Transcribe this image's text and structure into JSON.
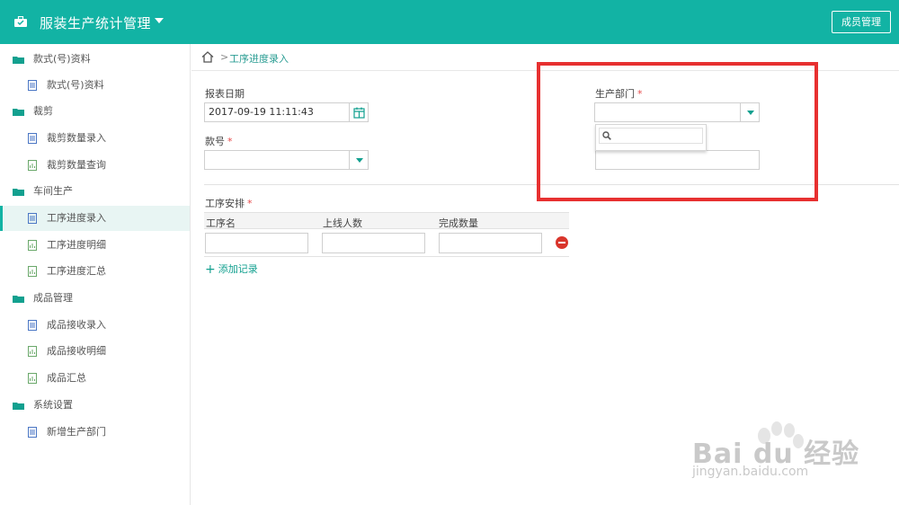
{
  "app": {
    "title": "服装生产统计管理",
    "member_button": "成员管理",
    "accent_color": "#12b3a4"
  },
  "sidebar": {
    "items": [
      {
        "type": "group",
        "label": "款式(号)资料"
      },
      {
        "type": "child",
        "label": "款式(号)资料"
      },
      {
        "type": "group",
        "label": "裁剪"
      },
      {
        "type": "child",
        "label": "裁剪数量录入"
      },
      {
        "type": "child",
        "label": "裁剪数量查询"
      },
      {
        "type": "group",
        "label": "车间生产"
      },
      {
        "type": "child",
        "label": "工序进度录入",
        "active": true
      },
      {
        "type": "child",
        "label": "工序进度明细"
      },
      {
        "type": "child",
        "label": "工序进度汇总"
      },
      {
        "type": "group",
        "label": "成品管理"
      },
      {
        "type": "child",
        "label": "成品接收录入"
      },
      {
        "type": "child",
        "label": "成品接收明细"
      },
      {
        "type": "child",
        "label": "成品汇总"
      },
      {
        "type": "group",
        "label": "系统设置"
      },
      {
        "type": "child",
        "label": "新增生产部门"
      }
    ]
  },
  "breadcrumb": {
    "separator": ">",
    "current": "工序进度录入"
  },
  "form": {
    "report_date_label": "报表日期",
    "report_date_value": "2017-09-19 11:11:43",
    "style_no_label": "款号",
    "department_label": "生产部门",
    "required_mark": "*",
    "process_label": "工序安排",
    "table_headers": [
      "工序名",
      "上线人数",
      "完成数量"
    ],
    "add_record": "添加记录"
  },
  "watermark": {
    "brand": "Bai du 经验",
    "url": "jingyan.baidu.com"
  }
}
